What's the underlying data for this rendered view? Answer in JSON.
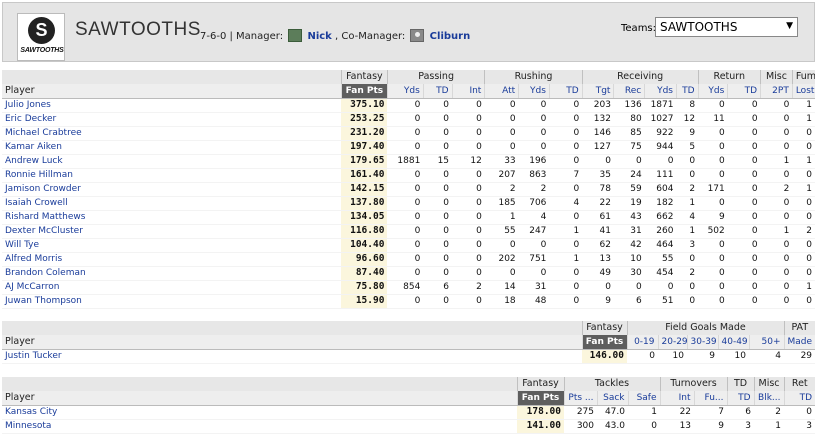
{
  "header": {
    "logo_text": "SAWTOOTHS",
    "team_name": "SAWTOOTHS",
    "record": "7-6-0",
    "manager_label": "| Manager:",
    "manager_name": "Nick",
    "comanager_label": ", Co-Manager:",
    "comanager_name": "Cliburn",
    "teams_label": "Teams:",
    "teams_selected": "SAWTOOTHS"
  },
  "offense": {
    "groups": [
      "",
      "Fantasy",
      "Passing",
      "Rushing",
      "Receiving",
      "Return",
      "Misc",
      "Fum"
    ],
    "columns": [
      "Player",
      "Fan Pts",
      "Yds",
      "TD",
      "Int",
      "Att",
      "Yds",
      "TD",
      "Tgt",
      "Rec",
      "Yds",
      "TD",
      "Yds",
      "TD",
      "2PT",
      "Lost"
    ],
    "rows": [
      [
        "Julio Jones",
        "375.10",
        "0",
        "0",
        "0",
        "0",
        "0",
        "0",
        "203",
        "136",
        "1871",
        "8",
        "0",
        "0",
        "0",
        "1"
      ],
      [
        "Eric Decker",
        "253.25",
        "0",
        "0",
        "0",
        "0",
        "0",
        "0",
        "132",
        "80",
        "1027",
        "12",
        "11",
        "0",
        "0",
        "1"
      ],
      [
        "Michael Crabtree",
        "231.20",
        "0",
        "0",
        "0",
        "0",
        "0",
        "0",
        "146",
        "85",
        "922",
        "9",
        "0",
        "0",
        "0",
        "0"
      ],
      [
        "Kamar Aiken",
        "197.40",
        "0",
        "0",
        "0",
        "0",
        "0",
        "0",
        "127",
        "75",
        "944",
        "5",
        "0",
        "0",
        "0",
        "0"
      ],
      [
        "Andrew Luck",
        "179.65",
        "1881",
        "15",
        "12",
        "33",
        "196",
        "0",
        "0",
        "0",
        "0",
        "0",
        "0",
        "0",
        "1",
        "1"
      ],
      [
        "Ronnie Hillman",
        "161.40",
        "0",
        "0",
        "0",
        "207",
        "863",
        "7",
        "35",
        "24",
        "111",
        "0",
        "0",
        "0",
        "0",
        "0"
      ],
      [
        "Jamison Crowder",
        "142.15",
        "0",
        "0",
        "0",
        "2",
        "2",
        "0",
        "78",
        "59",
        "604",
        "2",
        "171",
        "0",
        "2",
        "1"
      ],
      [
        "Isaiah Crowell",
        "137.80",
        "0",
        "0",
        "0",
        "185",
        "706",
        "4",
        "22",
        "19",
        "182",
        "1",
        "0",
        "0",
        "0",
        "0"
      ],
      [
        "Rishard Matthews",
        "134.05",
        "0",
        "0",
        "0",
        "1",
        "4",
        "0",
        "61",
        "43",
        "662",
        "4",
        "9",
        "0",
        "0",
        "0"
      ],
      [
        "Dexter McCluster",
        "116.80",
        "0",
        "0",
        "0",
        "55",
        "247",
        "1",
        "41",
        "31",
        "260",
        "1",
        "502",
        "0",
        "1",
        "2"
      ],
      [
        "Will Tye",
        "104.40",
        "0",
        "0",
        "0",
        "0",
        "0",
        "0",
        "62",
        "42",
        "464",
        "3",
        "0",
        "0",
        "0",
        "0"
      ],
      [
        "Alfred Morris",
        "96.60",
        "0",
        "0",
        "0",
        "202",
        "751",
        "1",
        "13",
        "10",
        "55",
        "0",
        "0",
        "0",
        "0",
        "0"
      ],
      [
        "Brandon Coleman",
        "87.40",
        "0",
        "0",
        "0",
        "0",
        "0",
        "0",
        "49",
        "30",
        "454",
        "2",
        "0",
        "0",
        "0",
        "0"
      ],
      [
        "AJ McCarron",
        "75.80",
        "854",
        "6",
        "2",
        "14",
        "31",
        "0",
        "0",
        "0",
        "0",
        "0",
        "0",
        "0",
        "0",
        "1"
      ],
      [
        "Juwan Thompson",
        "15.90",
        "0",
        "0",
        "0",
        "18",
        "48",
        "0",
        "9",
        "6",
        "51",
        "0",
        "0",
        "0",
        "0",
        "0"
      ]
    ]
  },
  "kicker": {
    "groups": [
      "",
      "Fantasy",
      "Field Goals Made",
      "PAT"
    ],
    "columns": [
      "Player",
      "Fan Pts",
      "0-19",
      "20-29",
      "30-39",
      "40-49",
      "50+",
      "Made"
    ],
    "rows": [
      [
        "Justin Tucker",
        "146.00",
        "0",
        "10",
        "9",
        "10",
        "4",
        "29"
      ]
    ]
  },
  "defense": {
    "groups": [
      "",
      "Fantasy",
      "Tackles",
      "Turnovers",
      "TD",
      "Misc",
      "Ret"
    ],
    "columns": [
      "Player",
      "Fan Pts",
      "Pts ...",
      "Sack",
      "Safe",
      "Int",
      "Fu...",
      "TD",
      "Blk...",
      "TD"
    ],
    "rows": [
      [
        "Kansas City",
        "178.00",
        "275",
        "47.0",
        "1",
        "22",
        "7",
        "6",
        "2",
        "0"
      ],
      [
        "Minnesota",
        "141.00",
        "300",
        "43.0",
        "0",
        "13",
        "9",
        "3",
        "1",
        "3"
      ]
    ]
  }
}
